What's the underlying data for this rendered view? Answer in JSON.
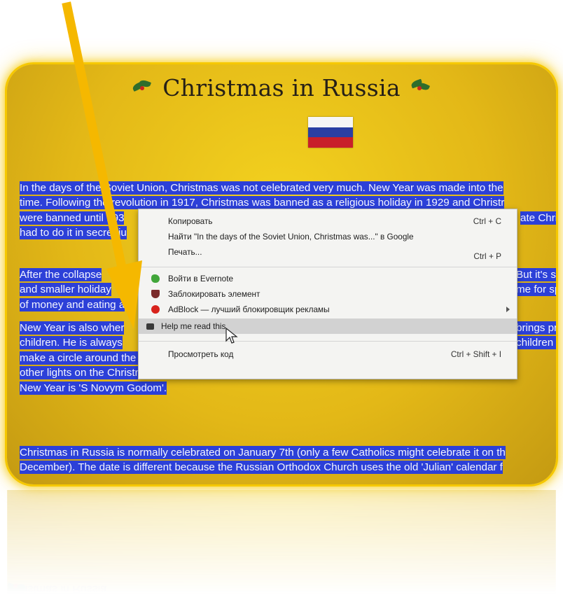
{
  "page": {
    "title": "Christmas in Russia",
    "flag_colors": [
      "#f6f6f6",
      "#2a3fa3",
      "#c81f2a"
    ],
    "background_color": "#e6bb18",
    "highlight_color": "#2c40d8",
    "arrow_color": "#f5b800"
  },
  "paragraphs": [
    {
      "lines": [
        "In the days of the Soviet Union, Christmas was not celebrated very much. New Year was made into the",
        "time. Following the revolution in 1917, Christmas was banned as a religious holiday in 1929 and Christr",
        "were banned until 193",
        "had to do it in secret ju"
      ],
      "visible_right": {
        "2": "ate Christ"
      }
    },
    {
      "lines": [
        "After the collapse",
        "and smaller holiday",
        "of money and eating a"
      ],
      "visible_right": {
        "0": "But it's st",
        "1": "me for spe"
      }
    },
    {
      "lines": [
        "New Year is also wher",
        "children. He is always",
        "make a circle around the Christmas tree and call for Snegurochka or Ded Moroz. When they appear the",
        "other lights on the Christmas tree light up! Ded Moroz carries a big magic staff. The traditional greetin",
        "New Year is 'S Novym Godom'."
      ],
      "visible_right": {
        "0": "brings pre",
        "1": "children h"
      }
    },
    {
      "lines": [
        "Christmas in Russia is normally celebrated on January 7th (only a few Catholics might celebrate it on th",
        "December). The date is different because the Russian Orthodox Church uses the old 'Julian' calendar f"
      ],
      "visible_right": {}
    }
  ],
  "context_menu": {
    "items": [
      {
        "label": "Копировать",
        "shortcut": "Ctrl + C",
        "icon": ""
      },
      {
        "label": "Найти \"In the days of the Soviet Union, Christmas was...\" в Google",
        "shortcut": "",
        "icon": ""
      },
      {
        "label": "Печать...",
        "shortcut": "Ctrl + P",
        "icon": ""
      },
      {
        "label": "Войти в Evernote",
        "shortcut": "",
        "icon": "evernote-icon"
      },
      {
        "label": "Заблокировать элемент",
        "shortcut": "",
        "icon": "shield-icon"
      },
      {
        "label": "AdBlock — лучший блокировщик рекламы",
        "shortcut": "",
        "icon": "adblock-icon",
        "submenu": true
      },
      {
        "label": "Help me read this",
        "shortcut": "",
        "icon": "reader-icon",
        "hovered": true
      },
      {
        "label": "Просмотреть код",
        "shortcut": "Ctrl + Shift + I",
        "icon": ""
      }
    ]
  }
}
